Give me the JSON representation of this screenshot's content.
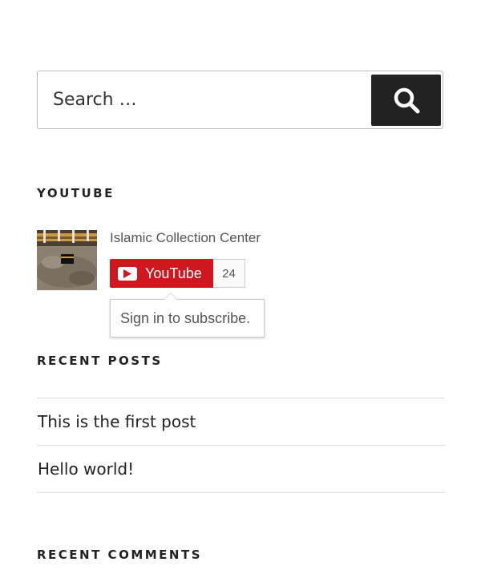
{
  "search": {
    "placeholder": "Search …",
    "button_icon": "search-icon"
  },
  "youtube_widget": {
    "title": "YOUTUBE",
    "channel_name": "Islamic Collection Center",
    "subscribe_label": "YouTube",
    "subscriber_count": "24",
    "tooltip": "Sign in to subscribe.",
    "brand_color": "#cc181e"
  },
  "recent_posts": {
    "title": "RECENT POSTS",
    "items": [
      {
        "label": "This is the first post"
      },
      {
        "label": "Hello world!"
      }
    ]
  },
  "recent_comments": {
    "title": "RECENT COMMENTS"
  }
}
